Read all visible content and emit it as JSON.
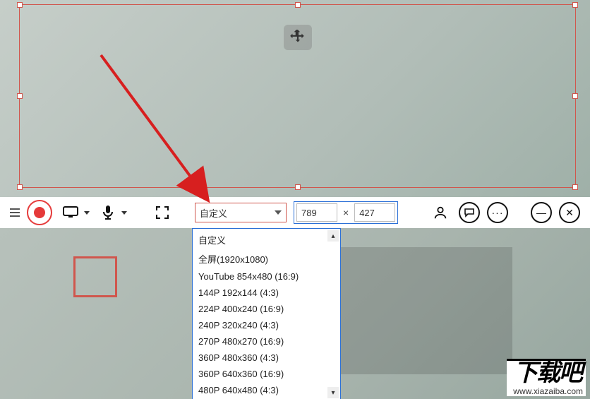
{
  "toolbar": {
    "record_label": "Record",
    "display_label": "Display source",
    "mic_label": "Microphone",
    "fullscreen_label": "Fullscreen toggle"
  },
  "preset": {
    "selected": "自定义",
    "options": [
      "自定义",
      "全屏(1920x1080)",
      "YouTube 854x480 (16:9)",
      "144P 192x144 (4:3)",
      "224P 400x240 (16:9)",
      "240P 320x240 (4:3)",
      "270P 480x270 (16:9)",
      "360P 480x360 (4:3)",
      "360P 640x360 (16:9)",
      "480P 640x480 (4:3)"
    ]
  },
  "dimensions": {
    "width": "789",
    "sep": "×",
    "height": "427"
  },
  "right_icons": {
    "user": "User",
    "chat": "Chat",
    "more": "More",
    "minimize": "—",
    "close": "✕"
  },
  "watermark": {
    "brand": "下载吧",
    "url": "www.xiazaiba.com"
  },
  "scroll": {
    "up": "▴",
    "down": "▾"
  }
}
